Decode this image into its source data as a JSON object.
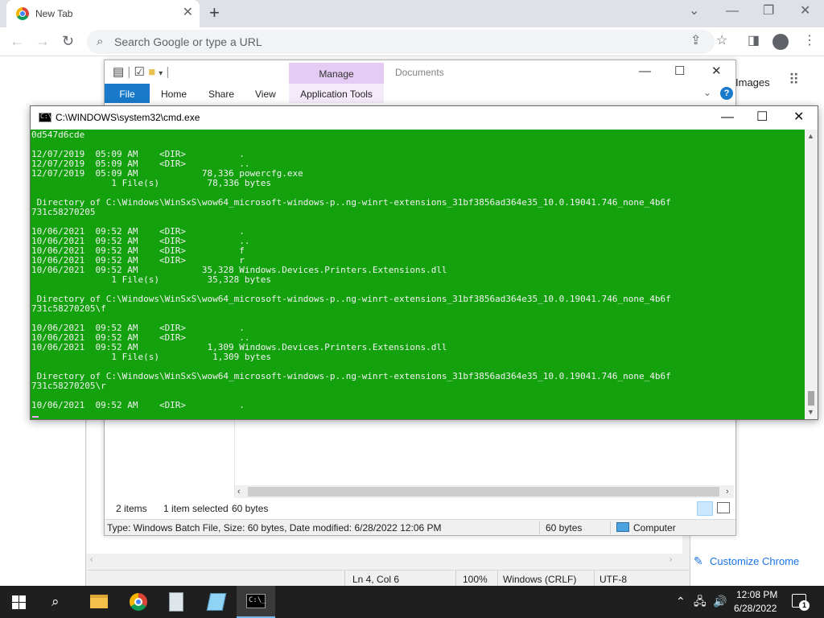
{
  "chrome": {
    "tab_title": "New Tab",
    "new_tab": "+",
    "omnibox_placeholder": "Search Google or type a URL",
    "ntp_images_link": "Images",
    "customize_label": "Customize Chrome",
    "icons": [
      "chrome-logo",
      "close-icon",
      "plus-icon",
      "back-arrow-icon",
      "forward-arrow-icon",
      "reload-icon",
      "search-icon",
      "share-icon",
      "star-icon",
      "side-panel-icon",
      "profile-icon",
      "more-vert-icon",
      "apps-grid-icon",
      "pencil-icon"
    ]
  },
  "explorer": {
    "manage_tab": "Manage",
    "app_tools_tab": "Application Tools",
    "window_title": "Documents",
    "tabs": [
      "File",
      "Home",
      "Share",
      "View"
    ],
    "help": "?",
    "status_items": "2 items",
    "status_selected": "1 item selected",
    "status_size": "60 bytes",
    "details_text": "Type: Windows Batch File, Size: 60 bytes, Date modified: 6/28/2022 12:06 PM",
    "details_size": "60 bytes",
    "details_location": "Computer"
  },
  "notepad": {
    "status_position": "Ln 4, Col 6",
    "status_zoom": "100%",
    "status_eol": "Windows (CRLF)",
    "status_encoding": "UTF-8"
  },
  "cmd": {
    "title": "C:\\WINDOWS\\system32\\cmd.exe",
    "console_color": "#13a10e",
    "lines": [
      "0d547d6cde",
      "",
      "12/07/2019  05:09 AM    <DIR>          .",
      "12/07/2019  05:09 AM    <DIR>          ..",
      "12/07/2019  05:09 AM            78,336 powercfg.exe",
      "               1 File(s)         78,336 bytes",
      "",
      " Directory of C:\\Windows\\WinSxS\\wow64_microsoft-windows-p..ng-winrt-extensions_31bf3856ad364e35_10.0.19041.746_none_4b6f",
      "731c58270205",
      "",
      "10/06/2021  09:52 AM    <DIR>          .",
      "10/06/2021  09:52 AM    <DIR>          ..",
      "10/06/2021  09:52 AM    <DIR>          f",
      "10/06/2021  09:52 AM    <DIR>          r",
      "10/06/2021  09:52 AM            35,328 Windows.Devices.Printers.Extensions.dll",
      "               1 File(s)         35,328 bytes",
      "",
      " Directory of C:\\Windows\\WinSxS\\wow64_microsoft-windows-p..ng-winrt-extensions_31bf3856ad364e35_10.0.19041.746_none_4b6f",
      "731c58270205\\f",
      "",
      "10/06/2021  09:52 AM    <DIR>          .",
      "10/06/2021  09:52 AM    <DIR>          ..",
      "10/06/2021  09:52 AM             1,309 Windows.Devices.Printers.Extensions.dll",
      "               1 File(s)          1,309 bytes",
      "",
      " Directory of C:\\Windows\\WinSxS\\wow64_microsoft-windows-p..ng-winrt-extensions_31bf3856ad364e35_10.0.19041.746_none_4b6f",
      "731c58270205\\r",
      "",
      "10/06/2021  09:52 AM    <DIR>          ."
    ]
  },
  "taskbar": {
    "time": "12:08 PM",
    "date": "6/28/2022",
    "notifications": "1",
    "apps": [
      "start-icon",
      "search-icon",
      "file-explorer-icon",
      "chrome-icon",
      "notepad-plus-plus-icon",
      "notepad-icon",
      "cmd-icon"
    ]
  }
}
